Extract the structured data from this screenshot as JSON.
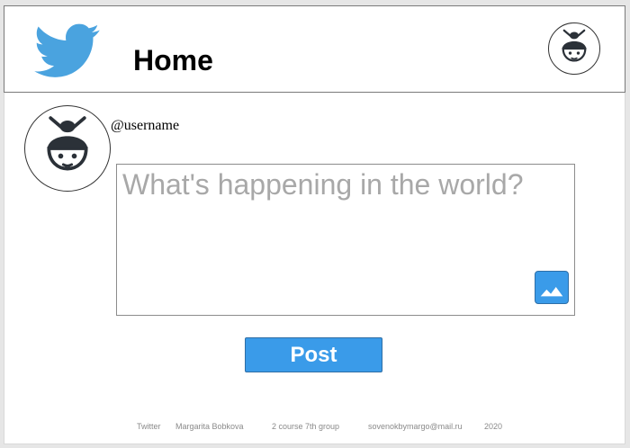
{
  "header": {
    "title": "Home",
    "logo_icon": "twitter-bird-icon",
    "profile_icon": "profile-avatar-icon"
  },
  "composer": {
    "username": "@username",
    "placeholder": "What's happening in the world?",
    "value": "",
    "image_button_icon": "image-icon",
    "post_label": "Post"
  },
  "footer": {
    "site": "Twitter",
    "author": "Margarita Bobkova",
    "group": "2 course 7th group",
    "email": "sovenokbymargo@mail.ru",
    "year": "2020"
  },
  "colors": {
    "accent": "#3a9be9",
    "logo": "#4aa3df",
    "avatar_dark": "#2b3138",
    "placeholder": "#a8a8a8"
  }
}
